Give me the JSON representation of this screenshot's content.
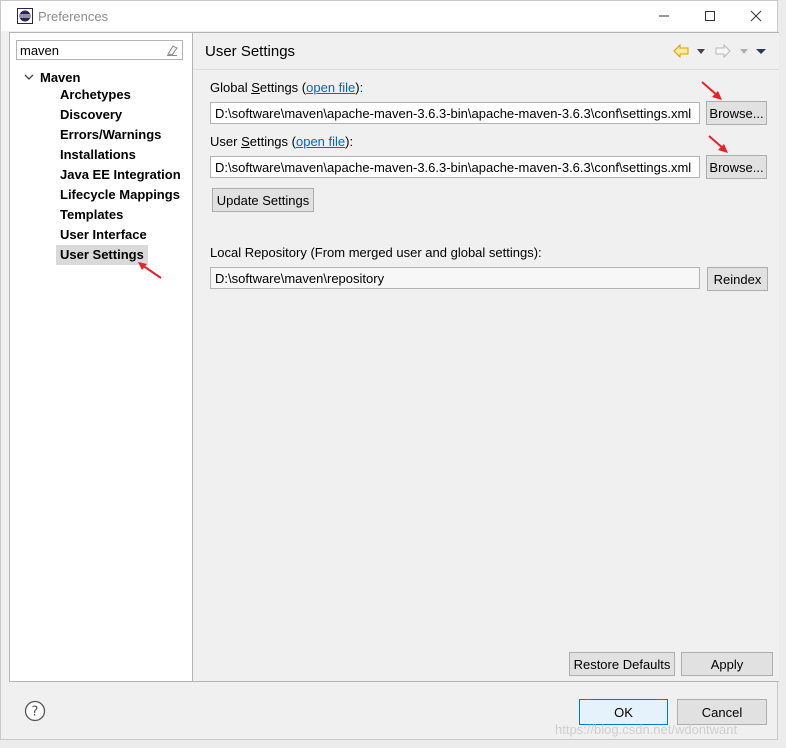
{
  "window": {
    "title": "Preferences"
  },
  "search": {
    "value": "maven"
  },
  "tree": {
    "root_label": "Maven",
    "children": [
      "Archetypes",
      "Discovery",
      "Errors/Warnings",
      "Installations",
      "Java EE Integration",
      "Lifecycle Mappings",
      "Templates",
      "User Interface",
      "User Settings"
    ],
    "selected": "User Settings"
  },
  "page": {
    "title": "User Settings",
    "global_label_pre": "Global ",
    "global_label_mnemonic": "S",
    "global_label_post": "ettings (",
    "global_link": "open file",
    "global_label_end": "):",
    "global_path": "D:\\software\\maven\\apache-maven-3.6.3-bin\\apache-maven-3.6.3\\conf\\settings.xml",
    "user_label_pre": "User ",
    "user_label_mnemonic": "S",
    "user_label_post": "ettings (",
    "user_link": "open file",
    "user_label_end": "):",
    "user_path": "D:\\software\\maven\\apache-maven-3.6.3-bin\\apache-maven-3.6.3\\conf\\settings.xml",
    "browse_label": "Browse...",
    "update_label": "Update Settings",
    "local_repo_label": "Local Repository (From merged user and global settings):",
    "local_repo_path": "D:\\software\\maven\\repository",
    "reindex_label": "Reindex"
  },
  "footer": {
    "restore_defaults": "Restore Defaults",
    "apply": "Apply",
    "ok": "OK",
    "cancel": "Cancel",
    "watermark": "https://blog.csdn.net/wdontwant"
  },
  "colors": {
    "link": "#0066cc",
    "annotation_arrow": "#e8202a",
    "nav_back_arrow": "#e0a800"
  },
  "icons": {
    "app": "eclipse-icon",
    "clear": "eraser-icon",
    "help": "question-circle-icon",
    "back": "back-arrow-icon",
    "forward": "forward-arrow-icon",
    "menu": "view-menu-icon"
  }
}
